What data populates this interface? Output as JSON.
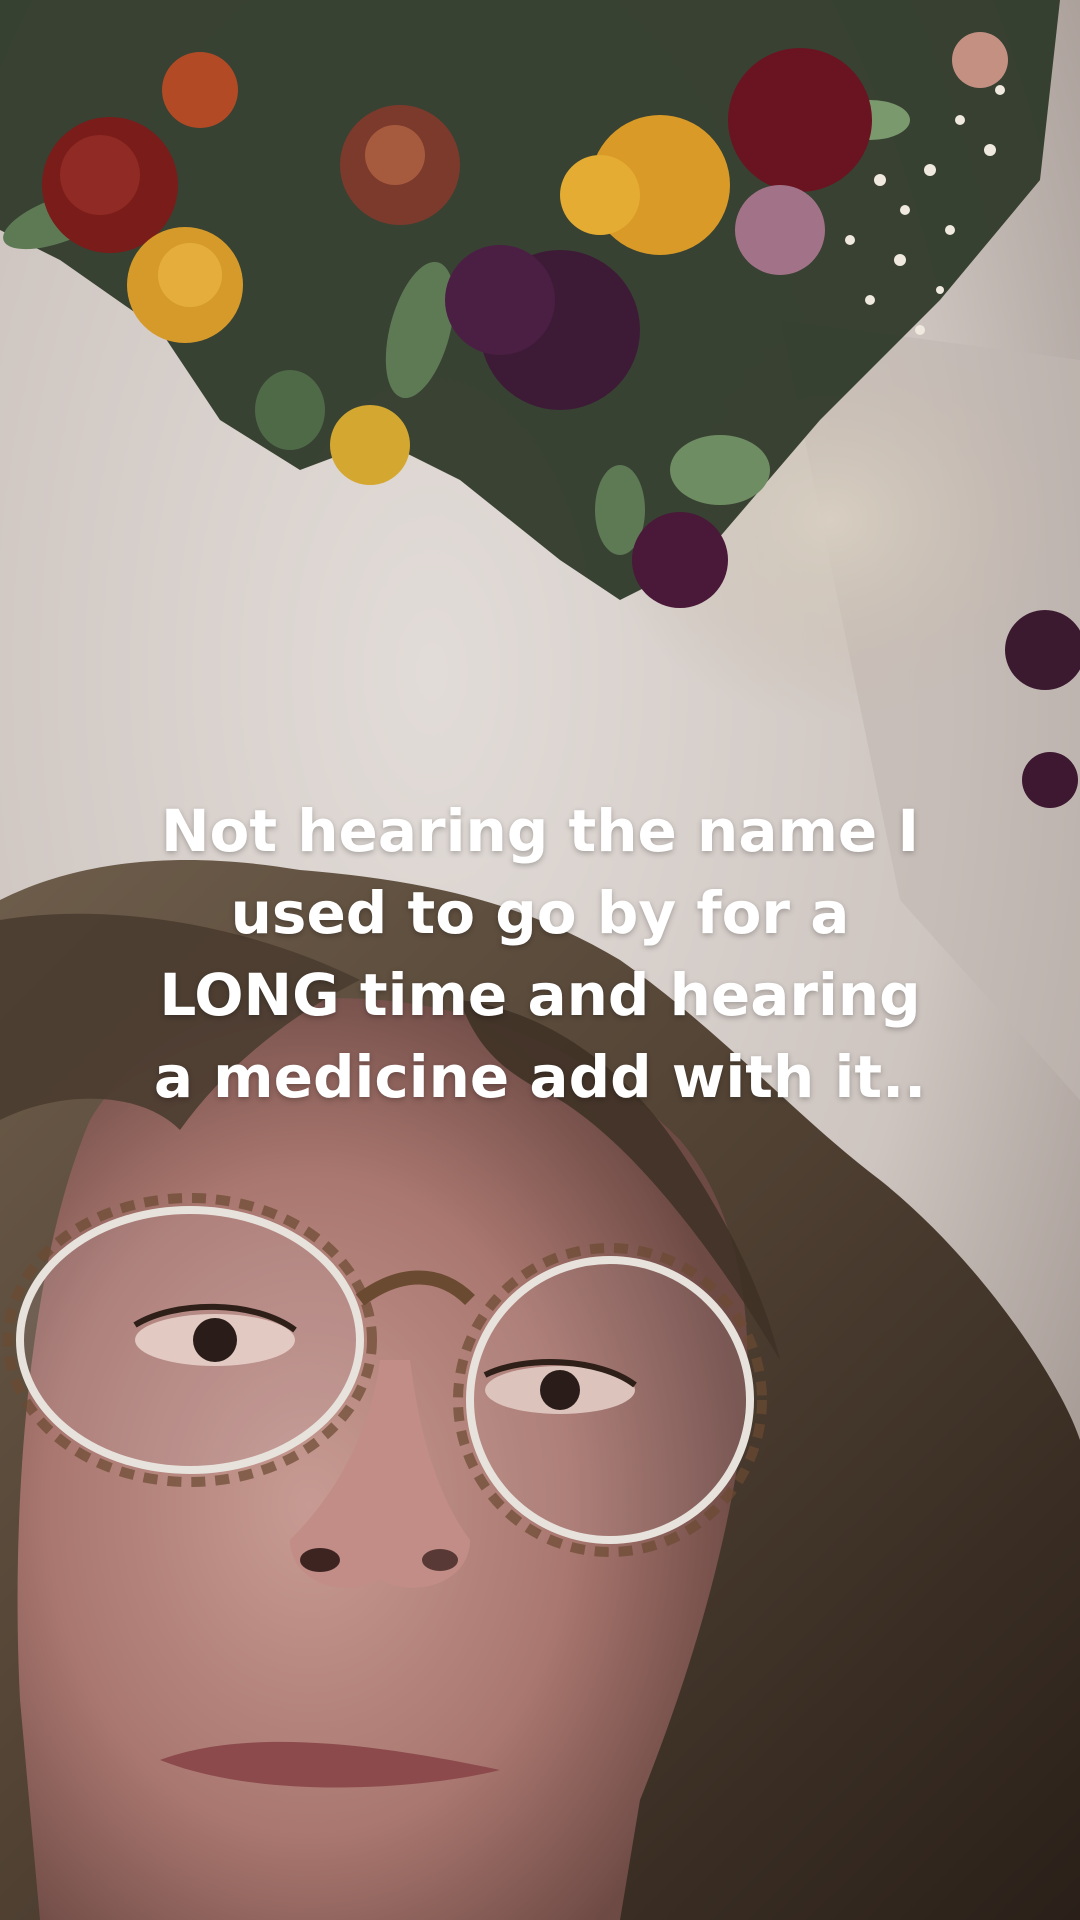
{
  "story": {
    "caption_lines": [
      "Not hearing the name I",
      "used to go by for a",
      "LONG time and hearing",
      "a medicine add with it.."
    ]
  },
  "colors": {
    "wall": "#d4ccc7",
    "hair": "#5a4a3c",
    "skin": "#b98a82",
    "caption_text": "#ffffff"
  }
}
